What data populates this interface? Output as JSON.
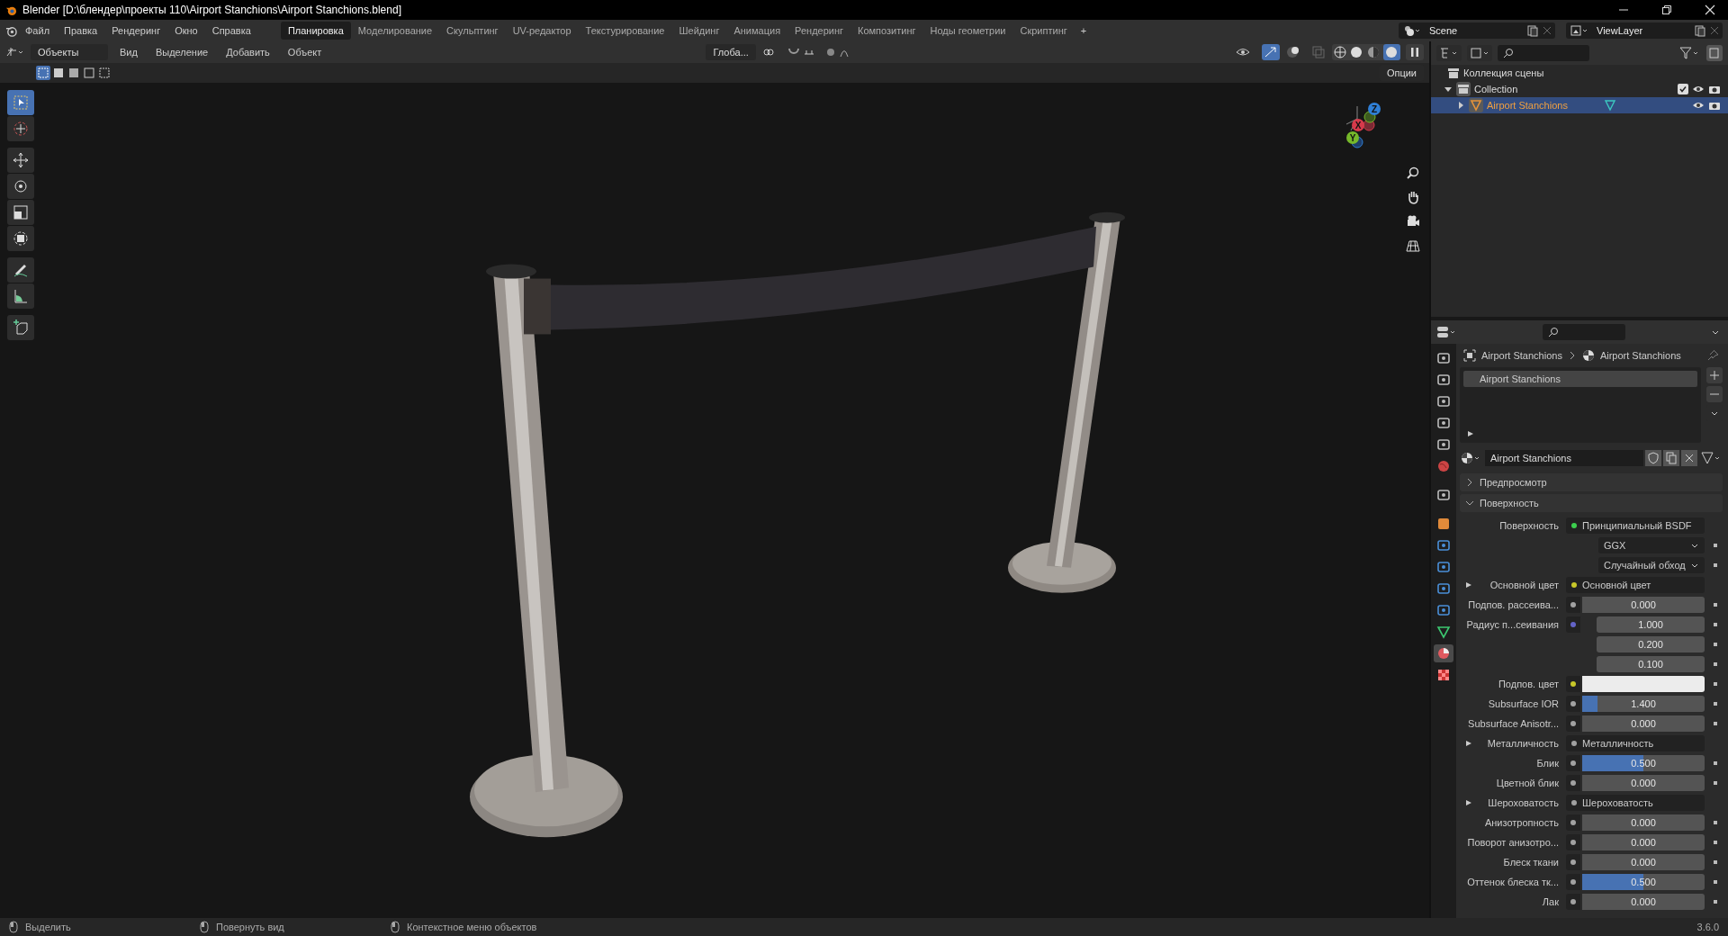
{
  "title_bar": {
    "title": "Blender [D:\\блендер\\проекты 110\\Airport Stanchions\\Airport Stanchions.blend]"
  },
  "menu": [
    "Файл",
    "Правка",
    "Рендеринг",
    "Окно",
    "Справка"
  ],
  "workspaces": [
    {
      "label": "Планировка",
      "selected": true
    },
    {
      "label": "Моделирование",
      "selected": false
    },
    {
      "label": "Скульптинг",
      "selected": false
    },
    {
      "label": "UV-редактор",
      "selected": false
    },
    {
      "label": "Текстурирование",
      "selected": false
    },
    {
      "label": "Шейдинг",
      "selected": false
    },
    {
      "label": "Анимация",
      "selected": false
    },
    {
      "label": "Рендеринг",
      "selected": false
    },
    {
      "label": "Композитинг",
      "selected": false
    },
    {
      "label": "Ноды геометрии",
      "selected": false
    },
    {
      "label": "Скриптинг",
      "selected": false
    }
  ],
  "add_workspace": "+",
  "scene": "Scene",
  "view_layer": "ViewLayer",
  "viewport": {
    "mode": "Объекты",
    "menus": [
      "Вид",
      "Выделение",
      "Добавить",
      "Объект"
    ],
    "orientation": "Глоба...",
    "options": "Опции",
    "tools": [
      {
        "kind": "select",
        "selected": true
      },
      {
        "kind": "cursor",
        "selected": false
      },
      {
        "kind": "move",
        "selected": false
      },
      {
        "kind": "rotate",
        "selected": false
      },
      {
        "kind": "scale",
        "selected": false
      },
      {
        "kind": "transform",
        "selected": false
      },
      {
        "kind": "annotate",
        "selected": false
      },
      {
        "kind": "measure",
        "selected": false
      },
      {
        "kind": "add",
        "selected": false
      }
    ],
    "axes": [
      {
        "label": "Z",
        "color": "#2f7fd6"
      },
      {
        "label": "X",
        "color": "#d63a4b"
      },
      {
        "label": "Y",
        "color": "#76b82a"
      }
    ]
  },
  "outliner": {
    "tree": [
      {
        "label": "Коллекция сцены",
        "kind": "scene",
        "children": [
          {
            "label": "Collection",
            "kind": "collection",
            "expanded": true,
            "selected": false,
            "children": [
              {
                "label": "Airport Stanchions",
                "kind": "object",
                "expanded": false,
                "selected": true
              }
            ]
          }
        ]
      }
    ]
  },
  "properties": {
    "tabs": [
      {
        "selected": false
      },
      {
        "selected": false
      },
      {
        "selected": false
      },
      {
        "selected": false
      },
      {
        "selected": false
      },
      {
        "selected": false
      },
      {
        "selected": false
      },
      {
        "selected": false
      },
      {
        "selected": false
      },
      {
        "selected": false
      },
      {
        "selected": false
      },
      {
        "selected": false
      },
      {
        "selected": false
      },
      {
        "selected": true
      },
      {
        "selected": false
      }
    ],
    "breadcrumb": [
      "Airport Stanchions",
      "Airport Stanchions"
    ],
    "slots": [
      {
        "label": "Airport Stanchions",
        "selected": true
      }
    ],
    "material": "Airport Stanchions",
    "panels": [
      {
        "label": "Предпросмотр",
        "expanded": false
      },
      {
        "label": "Поверхность",
        "expanded": true
      }
    ],
    "rows": [
      {
        "kind": "link",
        "label": "Поверхность",
        "expandable": false,
        "color": "#3ccf4e",
        "value": "Принципиальный BSDF"
      },
      {
        "kind": "dropdown",
        "value": "GGX"
      },
      {
        "kind": "dropdown",
        "value": "Случайный обход"
      },
      {
        "kind": "link",
        "label": "Основной цвет",
        "expandable": true,
        "color": "#c7c729",
        "value": "Основной цвет"
      },
      {
        "kind": "value",
        "label": "Подпов. рассеива...",
        "color": "#a1a1a1",
        "value": "0.000"
      },
      {
        "kind": "vector",
        "label": "Радиус п...сеивания",
        "color": "#6363c7",
        "values": [
          "1.000",
          "0.200",
          "0.100"
        ]
      },
      {
        "kind": "color",
        "label": "Подпов. цвет",
        "color": "#ececec"
      },
      {
        "kind": "value",
        "label": "Subsurface IOR",
        "color": "#a1a1a1",
        "value": "1.400",
        "level": 0.125
      },
      {
        "kind": "value",
        "label": "Subsurface Anisotr...",
        "color": "#a1a1a1",
        "value": "0.000"
      },
      {
        "kind": "link",
        "label": "Металличность",
        "expandable": true,
        "color": "#a1a1a1",
        "value": "Металличность"
      },
      {
        "kind": "value",
        "label": "Блик",
        "color": "#a1a1a1",
        "value": "0.500",
        "level": 0.5
      },
      {
        "kind": "value",
        "label": "Цветной блик",
        "color": "#a1a1a1",
        "value": "0.000"
      },
      {
        "kind": "link",
        "label": "Шероховатость",
        "expandable": true,
        "color": "#a1a1a1",
        "value": "Шероховатость"
      },
      {
        "kind": "value",
        "label": "Анизотропность",
        "color": "#a1a1a1",
        "value": "0.000"
      },
      {
        "kind": "value",
        "label": "Поворот анизотро...",
        "color": "#a1a1a1",
        "value": "0.000"
      },
      {
        "kind": "value",
        "label": "Блеск ткани",
        "color": "#a1a1a1",
        "value": "0.000"
      },
      {
        "kind": "value",
        "label": "Оттенок блеска тк...",
        "color": "#a1a1a1",
        "value": "0.500",
        "level": 0.5
      },
      {
        "kind": "value",
        "label": "Лак",
        "color": "#a1a1a1",
        "value": "0.000"
      }
    ]
  },
  "status_bar": {
    "hints": [
      "Выделить",
      "Повернуть вид",
      "Контекстное меню объектов"
    ],
    "version": "3.6.0"
  }
}
